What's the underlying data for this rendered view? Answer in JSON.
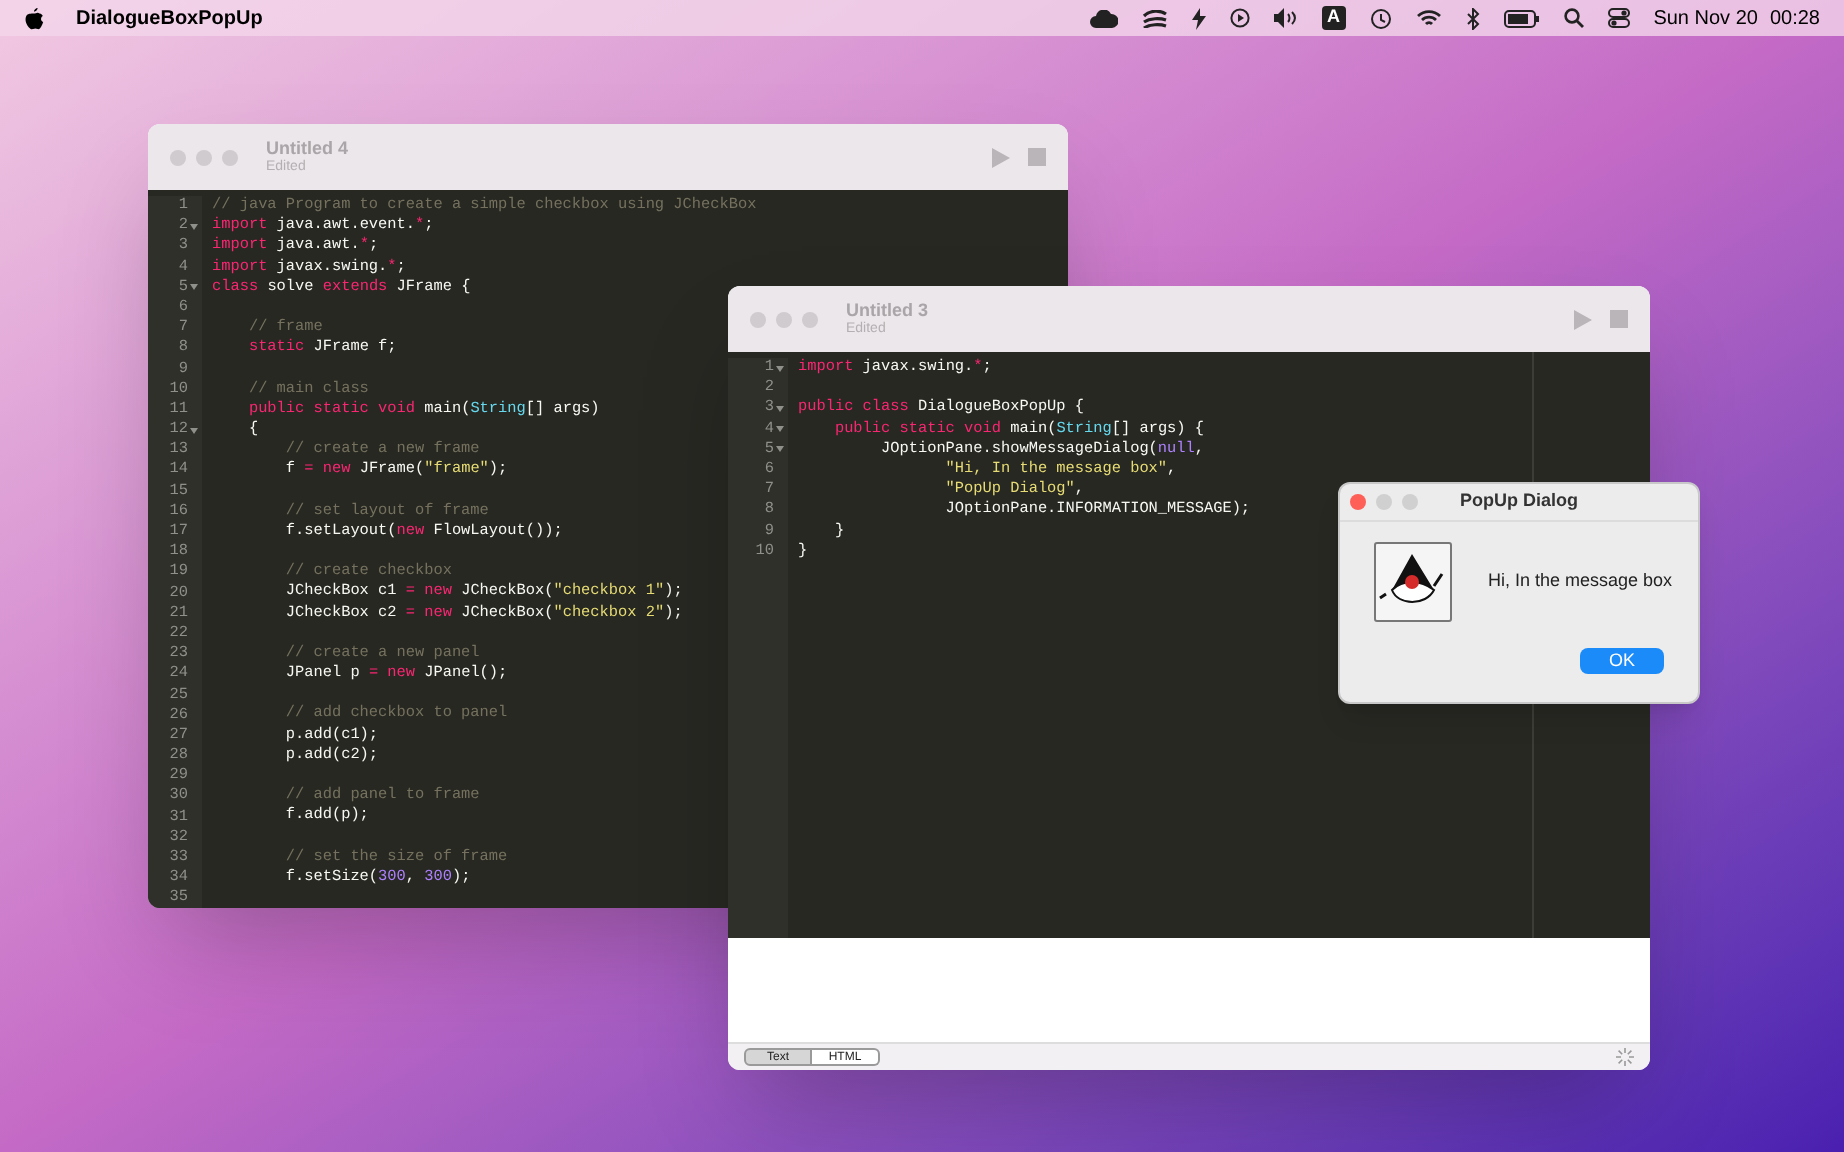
{
  "menu_bar": {
    "app_name": "DialogueBoxPopUp",
    "input_source": "A",
    "date": "Sun Nov 20",
    "time": "00:28"
  },
  "editors": [
    {
      "title": "Untitled 4",
      "subtitle": "Edited",
      "lines": [
        {
          "number": "1",
          "foldable": false,
          "tokens": [
            {
              "kind": "comment",
              "text": "// java Program to create a simple checkbox using JCheckBox"
            }
          ]
        },
        {
          "number": "2",
          "foldable": true,
          "tokens": [
            {
              "kind": "keyword",
              "text": "import"
            },
            {
              "kind": "plain",
              "text": " java.awt.event."
            },
            {
              "kind": "keyword",
              "text": "*"
            },
            {
              "kind": "plain",
              "text": ";"
            }
          ]
        },
        {
          "number": "3",
          "foldable": false,
          "tokens": [
            {
              "kind": "keyword",
              "text": "import"
            },
            {
              "kind": "plain",
              "text": " java.awt."
            },
            {
              "kind": "keyword",
              "text": "*"
            },
            {
              "kind": "plain",
              "text": ";"
            }
          ]
        },
        {
          "number": "4",
          "foldable": false,
          "tokens": [
            {
              "kind": "keyword",
              "text": "import"
            },
            {
              "kind": "plain",
              "text": " javax.swing."
            },
            {
              "kind": "keyword",
              "text": "*"
            },
            {
              "kind": "plain",
              "text": ";"
            }
          ]
        },
        {
          "number": "5",
          "foldable": true,
          "tokens": [
            {
              "kind": "keyword",
              "text": "class"
            },
            {
              "kind": "plain",
              "text": " solve "
            },
            {
              "kind": "keyword",
              "text": "extends"
            },
            {
              "kind": "plain",
              "text": " JFrame {"
            }
          ]
        },
        {
          "number": "6",
          "foldable": false
        },
        {
          "number": "7",
          "foldable": false,
          "tokens": [
            {
              "kind": "comment",
              "text": "    // frame"
            }
          ]
        },
        {
          "number": "8",
          "foldable": false,
          "tokens": [
            {
              "kind": "keyword",
              "text": "    static"
            },
            {
              "kind": "plain",
              "text": " JFrame f;"
            }
          ]
        },
        {
          "number": "9",
          "foldable": false
        },
        {
          "number": "10",
          "foldable": false,
          "tokens": [
            {
              "kind": "comment",
              "text": "    // main class"
            }
          ]
        },
        {
          "number": "11",
          "foldable": false,
          "tokens": [
            {
              "kind": "keyword",
              "text": "    public static void"
            },
            {
              "kind": "plain",
              "text": " main("
            },
            {
              "kind": "type",
              "text": "String"
            },
            {
              "kind": "plain",
              "text": "[] args)"
            }
          ]
        },
        {
          "number": "12",
          "foldable": true,
          "tokens": [
            {
              "kind": "plain",
              "text": "    {"
            }
          ]
        },
        {
          "number": "13",
          "foldable": false,
          "tokens": [
            {
              "kind": "comment",
              "text": "        // create a new frame"
            }
          ]
        },
        {
          "number": "14",
          "foldable": false,
          "tokens": [
            {
              "kind": "plain",
              "text": "        f "
            },
            {
              "kind": "keyword",
              "text": "= new"
            },
            {
              "kind": "plain",
              "text": " JFrame("
            },
            {
              "kind": "string",
              "text": "\"frame\""
            },
            {
              "kind": "plain",
              "text": ");"
            }
          ]
        },
        {
          "number": "15",
          "foldable": false
        },
        {
          "number": "16",
          "foldable": false,
          "tokens": [
            {
              "kind": "comment",
              "text": "        // set layout of frame"
            }
          ]
        },
        {
          "number": "17",
          "foldable": false,
          "tokens": [
            {
              "kind": "plain",
              "text": "        f.setLayout("
            },
            {
              "kind": "keyword",
              "text": "new"
            },
            {
              "kind": "plain",
              "text": " FlowLayout());"
            }
          ]
        },
        {
          "number": "18",
          "foldable": false
        },
        {
          "number": "19",
          "foldable": false,
          "tokens": [
            {
              "kind": "comment",
              "text": "        // create checkbox"
            }
          ]
        },
        {
          "number": "20",
          "foldable": false,
          "tokens": [
            {
              "kind": "plain",
              "text": "        JCheckBox c1 "
            },
            {
              "kind": "keyword",
              "text": "= new"
            },
            {
              "kind": "plain",
              "text": " JCheckBox("
            },
            {
              "kind": "string",
              "text": "\"checkbox 1\""
            },
            {
              "kind": "plain",
              "text": ");"
            }
          ]
        },
        {
          "number": "21",
          "foldable": false,
          "tokens": [
            {
              "kind": "plain",
              "text": "        JCheckBox c2 "
            },
            {
              "kind": "keyword",
              "text": "= new"
            },
            {
              "kind": "plain",
              "text": " JCheckBox("
            },
            {
              "kind": "string",
              "text": "\"checkbox 2\""
            },
            {
              "kind": "plain",
              "text": ");"
            }
          ]
        },
        {
          "number": "22",
          "foldable": false
        },
        {
          "number": "23",
          "foldable": false,
          "tokens": [
            {
              "kind": "comment",
              "text": "        // create a new panel"
            }
          ]
        },
        {
          "number": "24",
          "foldable": false,
          "tokens": [
            {
              "kind": "plain",
              "text": "        JPanel p "
            },
            {
              "kind": "keyword",
              "text": "= new"
            },
            {
              "kind": "plain",
              "text": " JPanel();"
            }
          ]
        },
        {
          "number": "25",
          "foldable": false
        },
        {
          "number": "26",
          "foldable": false,
          "tokens": [
            {
              "kind": "comment",
              "text": "        // add checkbox to panel"
            }
          ]
        },
        {
          "number": "27",
          "foldable": false,
          "tokens": [
            {
              "kind": "plain",
              "text": "        p.add(c1);"
            }
          ]
        },
        {
          "number": "28",
          "foldable": false,
          "tokens": [
            {
              "kind": "plain",
              "text": "        p.add(c2);"
            }
          ]
        },
        {
          "number": "29",
          "foldable": false
        },
        {
          "number": "30",
          "foldable": false,
          "tokens": [
            {
              "kind": "comment",
              "text": "        // add panel to frame"
            }
          ]
        },
        {
          "number": "31",
          "foldable": false,
          "tokens": [
            {
              "kind": "plain",
              "text": "        f.add(p);"
            }
          ]
        },
        {
          "number": "32",
          "foldable": false
        },
        {
          "number": "33",
          "foldable": false,
          "tokens": [
            {
              "kind": "comment",
              "text": "        // set the size of frame"
            }
          ]
        },
        {
          "number": "34",
          "foldable": false,
          "tokens": [
            {
              "kind": "plain",
              "text": "        f.setSize("
            },
            {
              "kind": "number",
              "text": "300"
            },
            {
              "kind": "plain",
              "text": ", "
            },
            {
              "kind": "number",
              "text": "300"
            },
            {
              "kind": "plain",
              "text": ");"
            }
          ]
        },
        {
          "number": "35",
          "foldable": false
        }
      ]
    },
    {
      "title": "Untitled 3",
      "subtitle": "Edited",
      "lines": [
        {
          "number": "1",
          "foldable": true,
          "tokens": [
            {
              "kind": "keyword",
              "text": "import"
            },
            {
              "kind": "plain",
              "text": " javax.swing."
            },
            {
              "kind": "keyword",
              "text": "*"
            },
            {
              "kind": "plain",
              "text": ";"
            }
          ]
        },
        {
          "number": "2",
          "foldable": false
        },
        {
          "number": "3",
          "foldable": true,
          "tokens": [
            {
              "kind": "keyword",
              "text": "public class"
            },
            {
              "kind": "plain",
              "text": " DialogueBoxPopUp {"
            }
          ]
        },
        {
          "number": "4",
          "foldable": true,
          "tokens": [
            {
              "kind": "keyword",
              "text": "    public static void"
            },
            {
              "kind": "plain",
              "text": " main("
            },
            {
              "kind": "type",
              "text": "String"
            },
            {
              "kind": "plain",
              "text": "[] args) {"
            }
          ]
        },
        {
          "number": "5",
          "foldable": true,
          "tokens": [
            {
              "kind": "plain",
              "text": "         JOptionPane.showMessageDialog("
            },
            {
              "kind": "number",
              "text": "null"
            },
            {
              "kind": "plain",
              "text": ","
            }
          ]
        },
        {
          "number": "6",
          "foldable": false,
          "tokens": [
            {
              "kind": "string",
              "text": "                \"Hi, In the message box\""
            },
            {
              "kind": "plain",
              "text": ","
            }
          ]
        },
        {
          "number": "7",
          "foldable": false,
          "tokens": [
            {
              "kind": "string",
              "text": "                \"PopUp Dialog\""
            },
            {
              "kind": "plain",
              "text": ","
            }
          ]
        },
        {
          "number": "8",
          "foldable": false,
          "tokens": [
            {
              "kind": "plain",
              "text": "                JOptionPane.INFORMATION_MESSAGE);"
            }
          ]
        },
        {
          "number": "9",
          "foldable": false,
          "tokens": [
            {
              "kind": "plain",
              "text": "    }"
            }
          ]
        },
        {
          "number": "10",
          "foldable": false,
          "tokens": [
            {
              "kind": "plain",
              "text": "}"
            }
          ]
        }
      ],
      "bottom_tabs": [
        {
          "label": "Text",
          "selected": true
        },
        {
          "label": "HTML",
          "selected": false
        }
      ]
    }
  ],
  "dialog": {
    "title": "PopUp Dialog",
    "message": "Hi, In the message box",
    "button": "OK"
  }
}
